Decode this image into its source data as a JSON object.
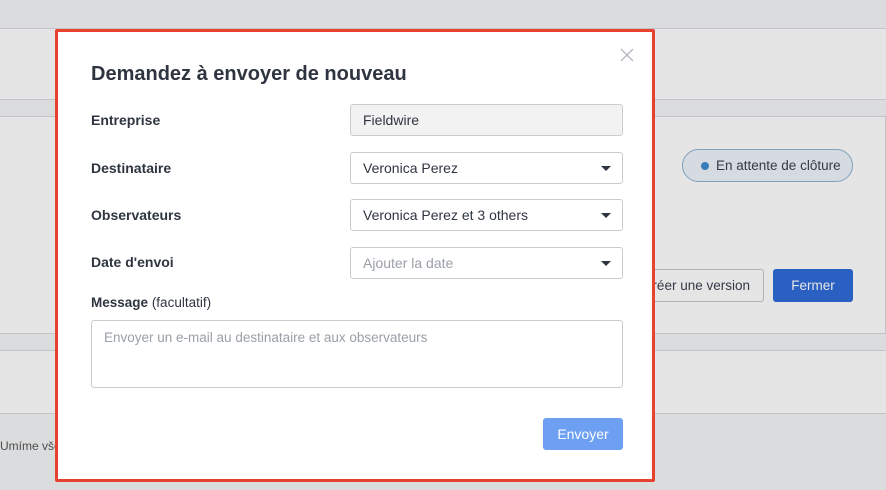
{
  "background": {
    "status_label": "En attente de clôture",
    "version_button": "Créer une version",
    "close_button": "Fermer",
    "truncated_text": "Umíme vše"
  },
  "modal": {
    "title": "Demandez à envoyer de nouveau",
    "close_icon": "close-icon",
    "fields": {
      "company": {
        "label": "Entreprise",
        "value": "Fieldwire"
      },
      "recipient": {
        "label": "Destinataire",
        "value": "Veronica Perez"
      },
      "observers": {
        "label": "Observateurs",
        "value": "Veronica Perez et 3 others"
      },
      "send_date": {
        "label": "Date d'envoi",
        "placeholder": "Ajouter la date"
      }
    },
    "message": {
      "label": "Message",
      "optional": "(facultatif)",
      "placeholder": "Envoyer un e-mail au destinataire et aux observateurs"
    },
    "send_button": "Envoyer"
  },
  "colors": {
    "highlight_border": "#e7412f",
    "primary_button": "#2f6bd9",
    "send_button": "#6d9ff2",
    "status_dot": "#3f8ad0"
  }
}
